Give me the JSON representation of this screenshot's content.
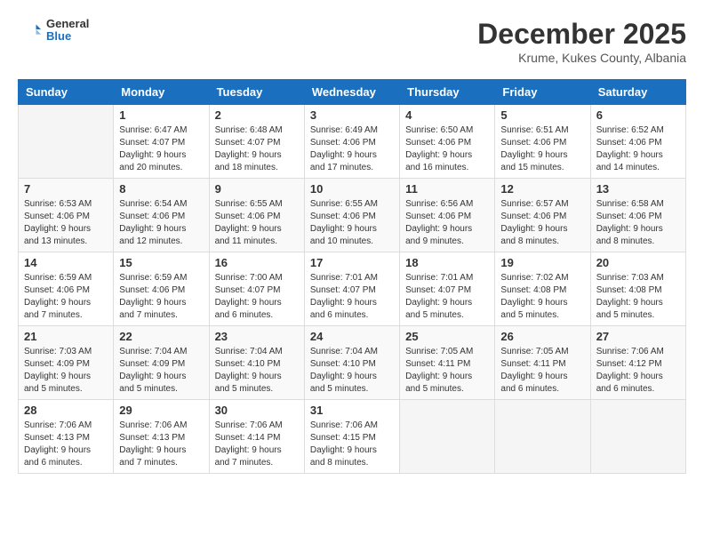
{
  "header": {
    "logo_general": "General",
    "logo_blue": "Blue",
    "month_title": "December 2025",
    "location": "Krume, Kukes County, Albania"
  },
  "days_of_week": [
    "Sunday",
    "Monday",
    "Tuesday",
    "Wednesday",
    "Thursday",
    "Friday",
    "Saturday"
  ],
  "weeks": [
    [
      {
        "day": "",
        "sunrise": "",
        "sunset": "",
        "daylight": ""
      },
      {
        "day": "1",
        "sunrise": "Sunrise: 6:47 AM",
        "sunset": "Sunset: 4:07 PM",
        "daylight": "Daylight: 9 hours and 20 minutes."
      },
      {
        "day": "2",
        "sunrise": "Sunrise: 6:48 AM",
        "sunset": "Sunset: 4:07 PM",
        "daylight": "Daylight: 9 hours and 18 minutes."
      },
      {
        "day": "3",
        "sunrise": "Sunrise: 6:49 AM",
        "sunset": "Sunset: 4:06 PM",
        "daylight": "Daylight: 9 hours and 17 minutes."
      },
      {
        "day": "4",
        "sunrise": "Sunrise: 6:50 AM",
        "sunset": "Sunset: 4:06 PM",
        "daylight": "Daylight: 9 hours and 16 minutes."
      },
      {
        "day": "5",
        "sunrise": "Sunrise: 6:51 AM",
        "sunset": "Sunset: 4:06 PM",
        "daylight": "Daylight: 9 hours and 15 minutes."
      },
      {
        "day": "6",
        "sunrise": "Sunrise: 6:52 AM",
        "sunset": "Sunset: 4:06 PM",
        "daylight": "Daylight: 9 hours and 14 minutes."
      }
    ],
    [
      {
        "day": "7",
        "sunrise": "Sunrise: 6:53 AM",
        "sunset": "Sunset: 4:06 PM",
        "daylight": "Daylight: 9 hours and 13 minutes."
      },
      {
        "day": "8",
        "sunrise": "Sunrise: 6:54 AM",
        "sunset": "Sunset: 4:06 PM",
        "daylight": "Daylight: 9 hours and 12 minutes."
      },
      {
        "day": "9",
        "sunrise": "Sunrise: 6:55 AM",
        "sunset": "Sunset: 4:06 PM",
        "daylight": "Daylight: 9 hours and 11 minutes."
      },
      {
        "day": "10",
        "sunrise": "Sunrise: 6:55 AM",
        "sunset": "Sunset: 4:06 PM",
        "daylight": "Daylight: 9 hours and 10 minutes."
      },
      {
        "day": "11",
        "sunrise": "Sunrise: 6:56 AM",
        "sunset": "Sunset: 4:06 PM",
        "daylight": "Daylight: 9 hours and 9 minutes."
      },
      {
        "day": "12",
        "sunrise": "Sunrise: 6:57 AM",
        "sunset": "Sunset: 4:06 PM",
        "daylight": "Daylight: 9 hours and 8 minutes."
      },
      {
        "day": "13",
        "sunrise": "Sunrise: 6:58 AM",
        "sunset": "Sunset: 4:06 PM",
        "daylight": "Daylight: 9 hours and 8 minutes."
      }
    ],
    [
      {
        "day": "14",
        "sunrise": "Sunrise: 6:59 AM",
        "sunset": "Sunset: 4:06 PM",
        "daylight": "Daylight: 9 hours and 7 minutes."
      },
      {
        "day": "15",
        "sunrise": "Sunrise: 6:59 AM",
        "sunset": "Sunset: 4:06 PM",
        "daylight": "Daylight: 9 hours and 7 minutes."
      },
      {
        "day": "16",
        "sunrise": "Sunrise: 7:00 AM",
        "sunset": "Sunset: 4:07 PM",
        "daylight": "Daylight: 9 hours and 6 minutes."
      },
      {
        "day": "17",
        "sunrise": "Sunrise: 7:01 AM",
        "sunset": "Sunset: 4:07 PM",
        "daylight": "Daylight: 9 hours and 6 minutes."
      },
      {
        "day": "18",
        "sunrise": "Sunrise: 7:01 AM",
        "sunset": "Sunset: 4:07 PM",
        "daylight": "Daylight: 9 hours and 5 minutes."
      },
      {
        "day": "19",
        "sunrise": "Sunrise: 7:02 AM",
        "sunset": "Sunset: 4:08 PM",
        "daylight": "Daylight: 9 hours and 5 minutes."
      },
      {
        "day": "20",
        "sunrise": "Sunrise: 7:03 AM",
        "sunset": "Sunset: 4:08 PM",
        "daylight": "Daylight: 9 hours and 5 minutes."
      }
    ],
    [
      {
        "day": "21",
        "sunrise": "Sunrise: 7:03 AM",
        "sunset": "Sunset: 4:09 PM",
        "daylight": "Daylight: 9 hours and 5 minutes."
      },
      {
        "day": "22",
        "sunrise": "Sunrise: 7:04 AM",
        "sunset": "Sunset: 4:09 PM",
        "daylight": "Daylight: 9 hours and 5 minutes."
      },
      {
        "day": "23",
        "sunrise": "Sunrise: 7:04 AM",
        "sunset": "Sunset: 4:10 PM",
        "daylight": "Daylight: 9 hours and 5 minutes."
      },
      {
        "day": "24",
        "sunrise": "Sunrise: 7:04 AM",
        "sunset": "Sunset: 4:10 PM",
        "daylight": "Daylight: 9 hours and 5 minutes."
      },
      {
        "day": "25",
        "sunrise": "Sunrise: 7:05 AM",
        "sunset": "Sunset: 4:11 PM",
        "daylight": "Daylight: 9 hours and 5 minutes."
      },
      {
        "day": "26",
        "sunrise": "Sunrise: 7:05 AM",
        "sunset": "Sunset: 4:11 PM",
        "daylight": "Daylight: 9 hours and 6 minutes."
      },
      {
        "day": "27",
        "sunrise": "Sunrise: 7:06 AM",
        "sunset": "Sunset: 4:12 PM",
        "daylight": "Daylight: 9 hours and 6 minutes."
      }
    ],
    [
      {
        "day": "28",
        "sunrise": "Sunrise: 7:06 AM",
        "sunset": "Sunset: 4:13 PM",
        "daylight": "Daylight: 9 hours and 6 minutes."
      },
      {
        "day": "29",
        "sunrise": "Sunrise: 7:06 AM",
        "sunset": "Sunset: 4:13 PM",
        "daylight": "Daylight: 9 hours and 7 minutes."
      },
      {
        "day": "30",
        "sunrise": "Sunrise: 7:06 AM",
        "sunset": "Sunset: 4:14 PM",
        "daylight": "Daylight: 9 hours and 7 minutes."
      },
      {
        "day": "31",
        "sunrise": "Sunrise: 7:06 AM",
        "sunset": "Sunset: 4:15 PM",
        "daylight": "Daylight: 9 hours and 8 minutes."
      },
      {
        "day": "",
        "sunrise": "",
        "sunset": "",
        "daylight": ""
      },
      {
        "day": "",
        "sunrise": "",
        "sunset": "",
        "daylight": ""
      },
      {
        "day": "",
        "sunrise": "",
        "sunset": "",
        "daylight": ""
      }
    ]
  ]
}
